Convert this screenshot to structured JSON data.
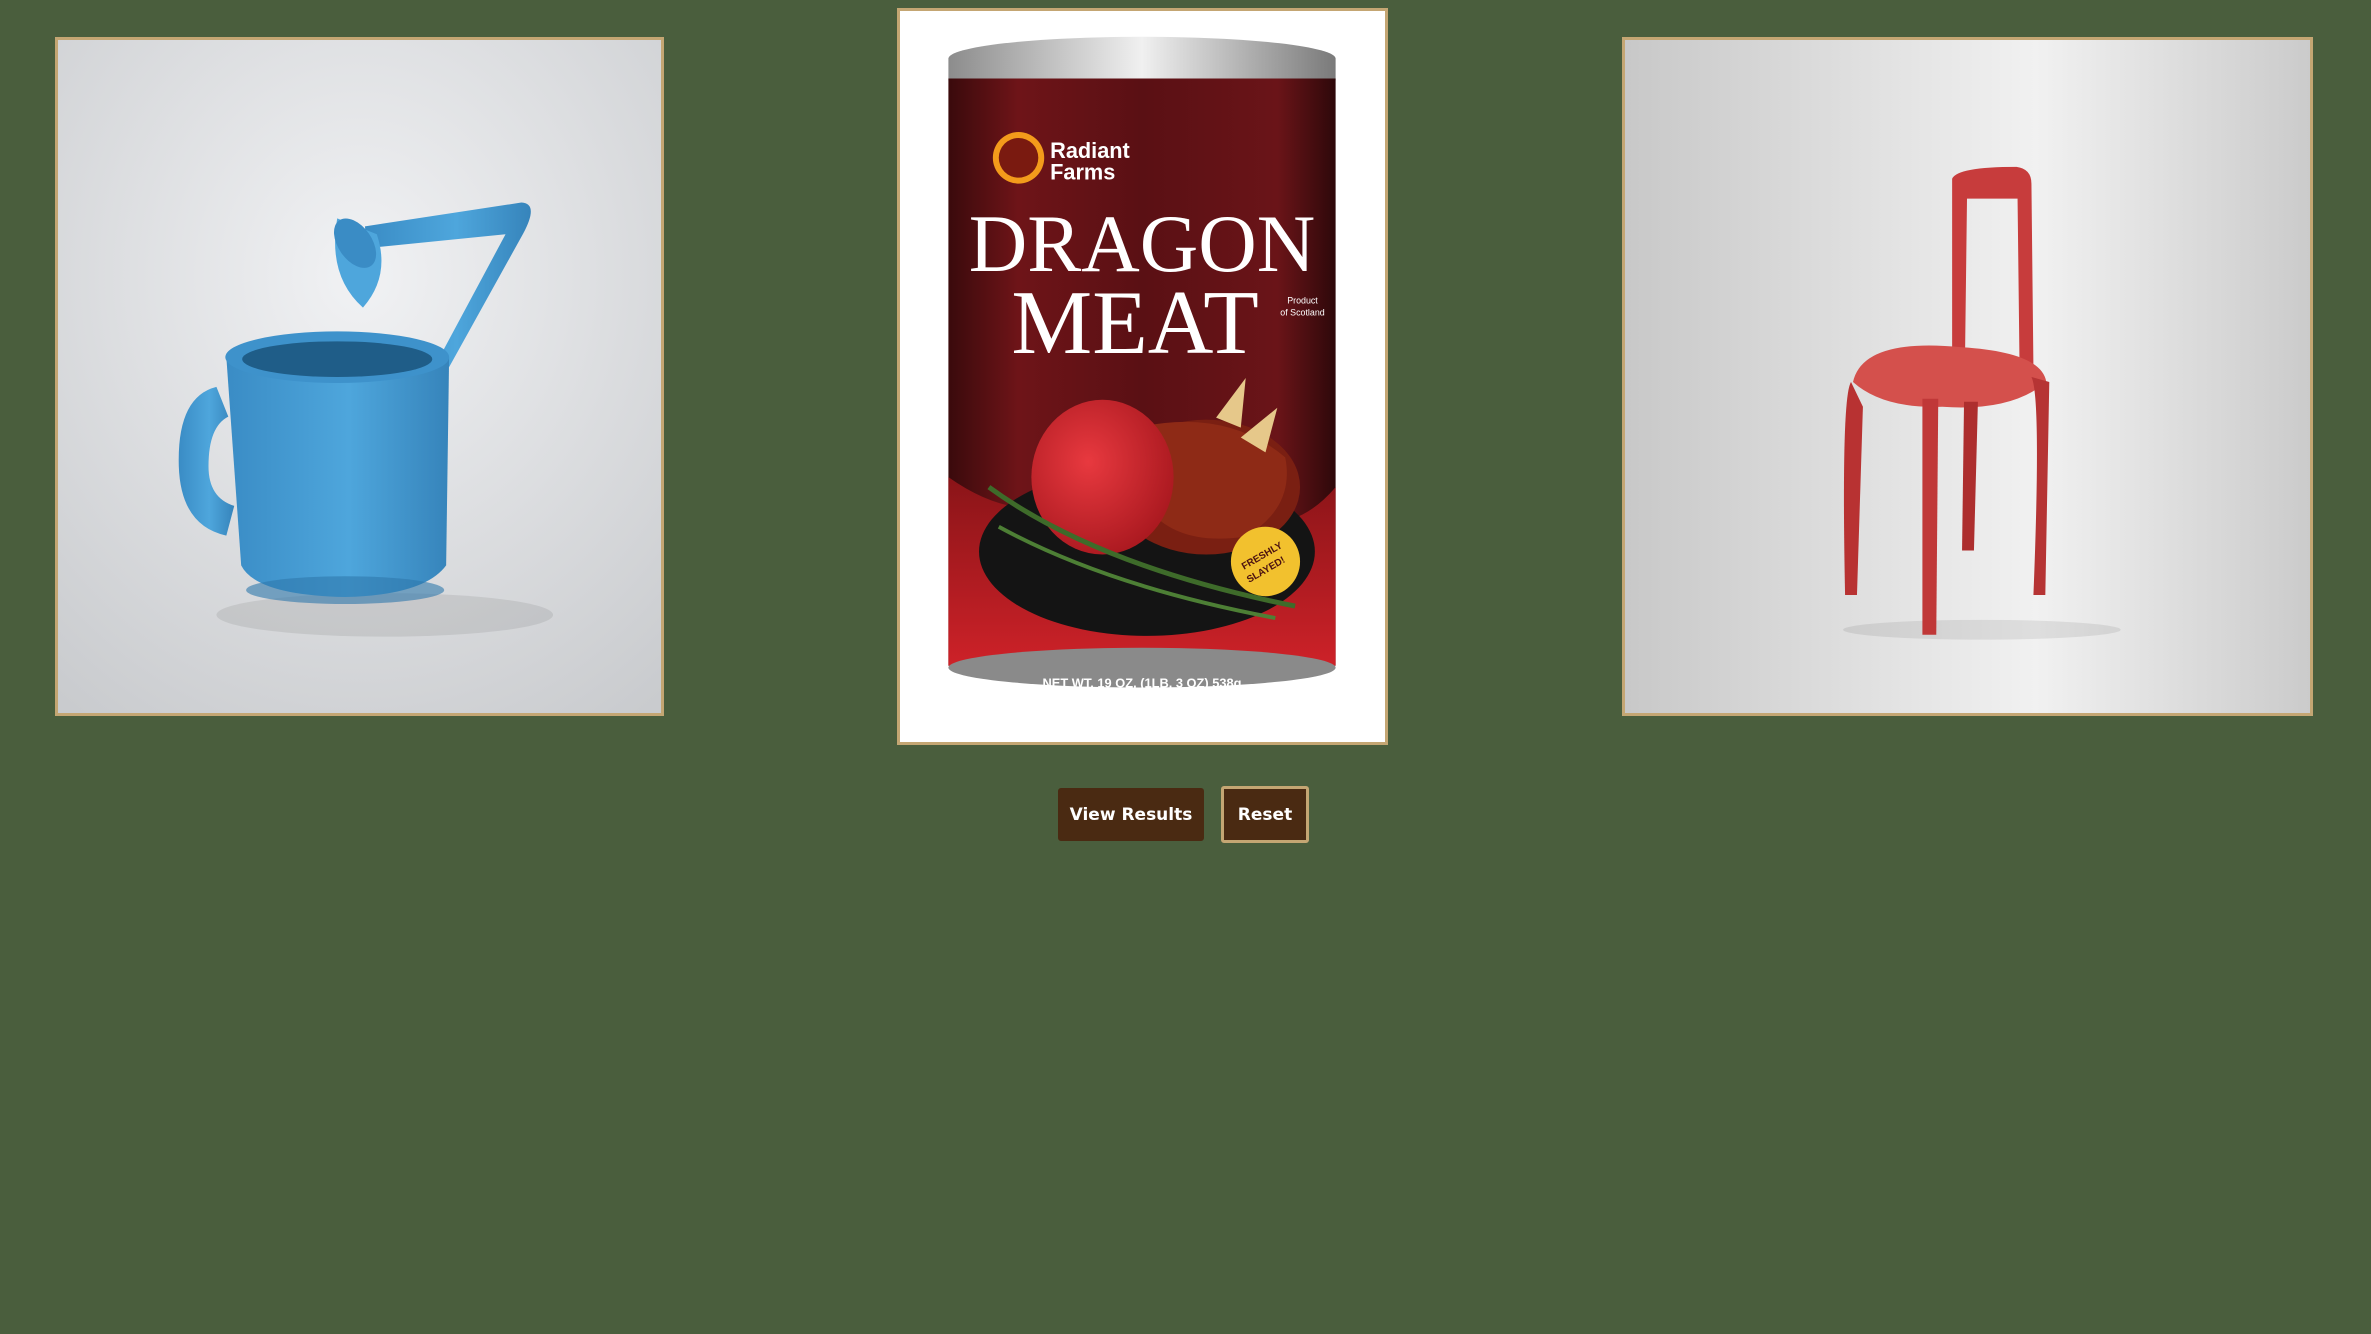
{
  "products": {
    "left": {
      "icon": "watering-can-image"
    },
    "center": {
      "icon": "dragon-meat-can-image",
      "brand_line1": "Radiant",
      "brand_line2": "Farms",
      "title_line1": "DRAGON",
      "title_line2": "MEAT",
      "origin_line1": "Product",
      "origin_line2": "of Scotland",
      "badge_line1": "FRESHLY",
      "badge_line2": "SLAYED!",
      "net_weight": "NET WT. 19 OZ. (1LB. 3 OZ) 538g"
    },
    "right": {
      "icon": "chair-image"
    }
  },
  "buttons": {
    "view_results": "View Results",
    "reset": "Reset"
  },
  "colors": {
    "background": "#4a5e3d",
    "frame_border": "#c4a673",
    "button_bg": "#4a2a12",
    "button_text": "#ffffff"
  }
}
